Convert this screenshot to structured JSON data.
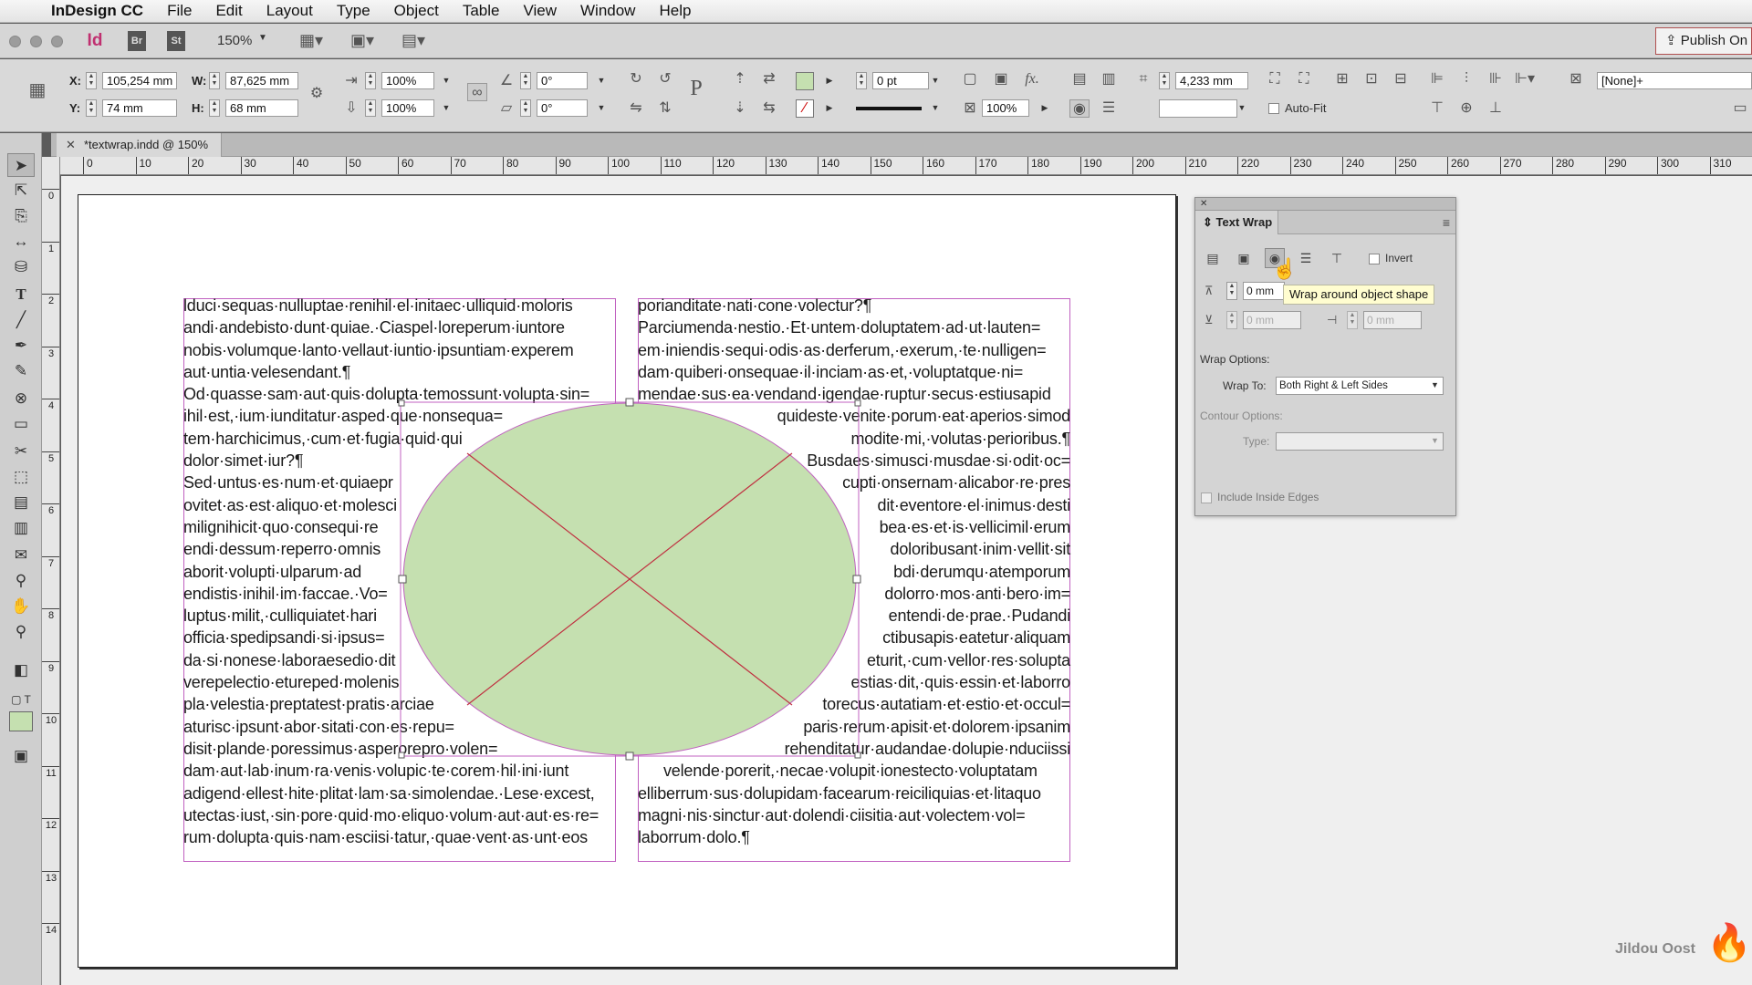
{
  "menubar": {
    "app_name": "InDesign CC",
    "items": [
      "File",
      "Edit",
      "Layout",
      "Type",
      "Object",
      "Table",
      "View",
      "Window",
      "Help"
    ]
  },
  "appbar": {
    "app_icon": "Id",
    "bridge_icon": "Br",
    "stock_icon": "St",
    "zoom": "150%",
    "publish_label": "Publish On"
  },
  "control": {
    "x_label": "X:",
    "x_value": "105,254 mm",
    "y_label": "Y:",
    "y_value": "74 mm",
    "w_label": "W:",
    "w_value": "87,625 mm",
    "h_label": "H:",
    "h_value": "68 mm",
    "scale_x": "100%",
    "scale_y": "100%",
    "rotate": "0°",
    "shear": "0°",
    "stroke_weight": "0 pt",
    "opacity": "100%",
    "size_value": "4,233 mm",
    "autofit_label": "Auto-Fit",
    "object_style": "[None]+"
  },
  "document": {
    "tab_title": "*textwrap.indd @ 150%"
  },
  "ruler": {
    "h": [
      "0",
      "10",
      "20",
      "30",
      "40",
      "50",
      "60",
      "70",
      "80",
      "90",
      "100",
      "110",
      "120",
      "130",
      "140",
      "150",
      "160",
      "170",
      "180",
      "190",
      "200",
      "210",
      "220",
      "230",
      "240",
      "250",
      "260",
      "270",
      "280",
      "290",
      "300",
      "310"
    ],
    "v": [
      "0",
      "1",
      "2",
      "3",
      "4",
      "5",
      "6",
      "7",
      "8",
      "9",
      "10",
      "11",
      "12",
      "13",
      "14"
    ]
  },
  "text": {
    "left": [
      "lduci·sequas·nulluptae·renihil·el·initaec·ulliquid·moloris",
      "andi·andebisto·dunt·quiae.·Ciaspel·loreperum·iuntore",
      "nobis·volumque·lanto·vellaut·iuntio·ipsuntiam·experem",
      "aut·untia·velesendant.¶",
      "Od·quasse·sam·aut·quis·dolupta·temossunt·volupta·sin=",
      "ihil·est,·ium·iunditatur·asped·que·nonsequa=",
      "tem·harchicimus,·cum·et·fugia·quid·qui",
      "dolor·simet·iur?¶",
      "Sed·untus·es·num·et·quiaepr",
      "ovitet·as·est·aliquo·et·molesci",
      "milignihicit·quo·consequi·re",
      "endi·dessum·reperro·omnis",
      "aborit·volupti·ulparum·ad",
      "endistis·inihil·im·faccae.·Vo=",
      "luptus·milit,·culliquiatet·hari",
      "officia·spedipsandi·si·ipsus=",
      "da·si·nonese·laboraesedio·dit",
      "verepelectio·etureped·molenis",
      "pla·velestia·preptatest·pratis·arciae",
      "aturisc·ipsunt·abor·sitati·con·es·repu=",
      "disit·plande·poressimus·asperorepro·volen=",
      "dam·aut·lab·inum·ra·venis·volupic·te·corem·hil·ini·iunt",
      "adigend·ellest·hite·plitat·lam·sa·simolendae.·Lese·excest,",
      "utectas·iust,·sin·pore·quid·mo·eliquo·volum·aut·aut·es·re=",
      "rum·dolupta·quis·nam·esciisi·tatur,·quae·vent·as·unt·eos"
    ],
    "right": [
      "porianditate·nati·cone·volectur?¶",
      "Parciumenda·nestio.·Et·untem·doluptatem·ad·ut·lauten=",
      "em·iniendis·sequi·odis·as·derferum,·exerum,·te·nulligen=",
      "dam·quiberi·onsequae·il·inciam·as·et,·voluptatque·ni=",
      "mendae·sus·ea·vendand·igendae·ruptur·secus·estiusapid",
      "quideste·venite·porum·eat·aperios·simod",
      "modite·mi,·volutas·perioribus.¶",
      "Busdaes·simusci·musdae·si·odit·oc=",
      "cupti·onsernam·alicabor·re·pres",
      "dit·eventore·el·inimus·desti",
      "bea·es·et·is·vellicimil·erum",
      "doloribusant·inim·vellit·sit",
      "bdi·derumqu·atemporum",
      "dolorro·mos·anti·bero·im=",
      "entendi·de·prae.·Pudandi",
      "ctibusapis·eatetur·aliquam",
      "eturit,·cum·vellor·res·solupta",
      "estias·dit,·quis·essin·et·laborro",
      "torecus·autatiam·et·estio·et·occul=",
      "paris·rerum·apisit·et·dolorem·ipsanim",
      "rehenditatur·audandae·dolupie·nduciissi",
      "velende·porerit,·necae·volupit·ionestecto·voluptatam",
      "elliberrum·sus·dolupidam·facearum·reiciliquias·et·litaquo",
      "magni·nis·sinctur·aut·dolendi·ciisitia·aut·volectem·vol=",
      "laborrum·dolo.¶"
    ]
  },
  "panel": {
    "title": "Text Wrap",
    "invert_label": "Invert",
    "top_offset": "0 mm",
    "bottom_offset": "0 mm",
    "right_offset": "0 mm",
    "wrap_options_label": "Wrap Options:",
    "wrap_to_label": "Wrap To:",
    "wrap_to_value": "Both Right & Left Sides",
    "contour_label": "Contour Options:",
    "type_label": "Type:",
    "type_value": "",
    "include_edges_label": "Include Inside Edges",
    "tooltip": "Wrap around object shape"
  },
  "watermark": "Jildou Oost",
  "colors": {
    "ellipse_fill": "#c5e0b0",
    "frame_border": "#c060c0",
    "cross_lines": "#c03040"
  }
}
